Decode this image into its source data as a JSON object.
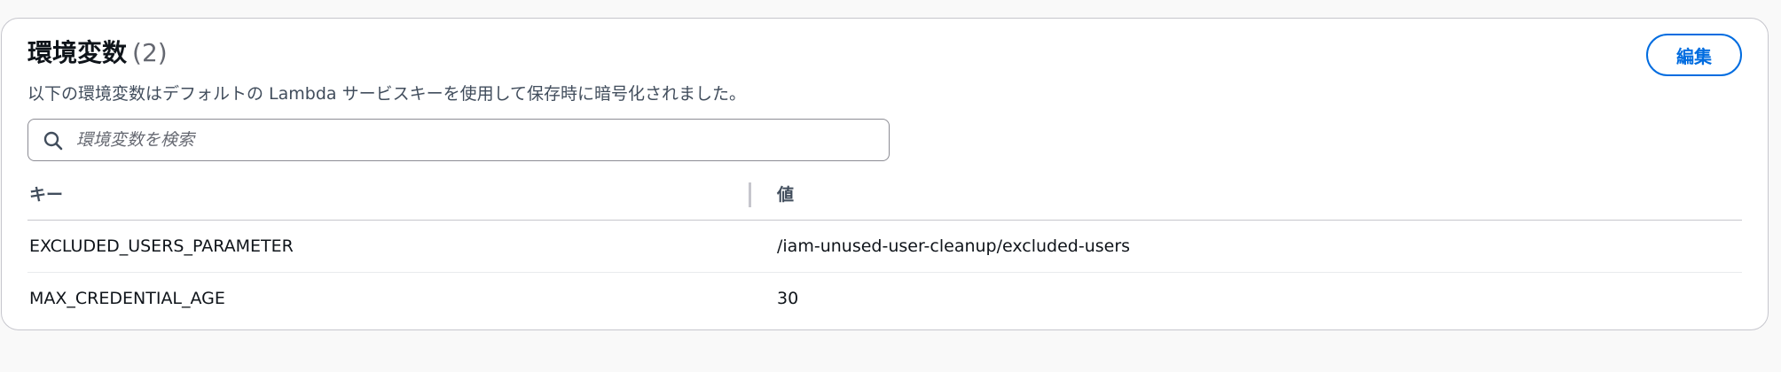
{
  "section": {
    "title": "環境変数",
    "count": "(2)",
    "description": "以下の環境変数はデフォルトの Lambda サービスキーを使用して保存時に暗号化されました。",
    "edit_label": "編集"
  },
  "search": {
    "placeholder": "環境変数を検索",
    "value": ""
  },
  "table": {
    "columns": {
      "key": "キー",
      "value": "値"
    },
    "rows": [
      {
        "key": "EXCLUDED_USERS_PARAMETER",
        "value": "/iam-unused-user-cleanup/excluded-users"
      },
      {
        "key": "MAX_CREDENTIAL_AGE",
        "value": "30"
      }
    ]
  },
  "colors": {
    "accent": "#006ce0",
    "border": "#c6c6cd",
    "text": "#0f141a",
    "muted": "#414d5c"
  },
  "icons": {
    "search": "search-icon"
  }
}
